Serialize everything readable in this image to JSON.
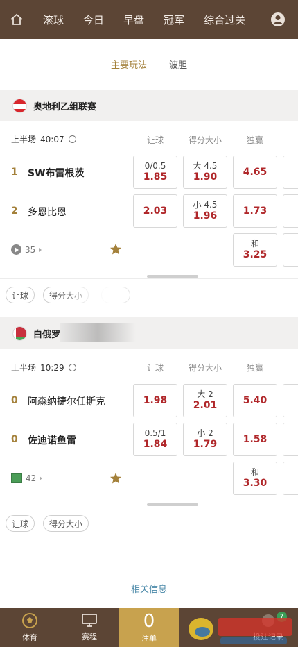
{
  "nav": {
    "tabs": [
      "滚球",
      "今日",
      "早盘",
      "冠军",
      "综合过关"
    ]
  },
  "subtabs": {
    "active": "主要玩法",
    "inactive": "波胆"
  },
  "columns": {
    "handicap": "让球",
    "totals": "得分大小",
    "moneyline": "独赢"
  },
  "matches": [
    {
      "league": "奥地利乙组联赛",
      "period": "上半场",
      "time": "40:07",
      "home": {
        "score": "1",
        "name": "SW布雷根茨",
        "hcp_line": "0/0.5",
        "hcp": "1.85",
        "ou_line": "大 4.5",
        "ou": "1.90",
        "ml": "4.65"
      },
      "away": {
        "score": "2",
        "name": "多恩比恩",
        "hcp_line": "",
        "hcp": "2.03",
        "ou_line": "小 4.5",
        "ou": "1.96",
        "ml": "1.73"
      },
      "draw": {
        "label": "和",
        "ml": "3.25"
      },
      "media_count": "35",
      "chips": [
        "让球",
        "得分大小"
      ]
    },
    {
      "league": "白俄罗",
      "period": "上半场",
      "time": "10:29",
      "home": {
        "score": "0",
        "name": "阿森纳捷尔任斯克",
        "hcp_line": "",
        "hcp": "1.98",
        "ou_line": "大 2",
        "ou": "2.01",
        "ml": "5.40"
      },
      "away": {
        "score": "0",
        "name": "佐迪诺鱼雷",
        "hcp_line": "0.5/1",
        "hcp": "1.84",
        "ou_line": "小 2",
        "ou": "1.79",
        "ml": "1.58"
      },
      "draw": {
        "label": "和",
        "ml": "3.30"
      },
      "media_count": "42",
      "chips": [
        "让球",
        "得分大小"
      ]
    }
  ],
  "related": "相关信息",
  "bottom": {
    "sports": "体育",
    "schedule": "赛程",
    "bet_count": "0",
    "bet_slip": "注单",
    "record": "投注记录",
    "record_badge": "7"
  },
  "colors": {
    "brand": "#5c4535",
    "accent": "#a4813b",
    "odds": "#b0272a",
    "bet_tab": "#c8a24e"
  }
}
